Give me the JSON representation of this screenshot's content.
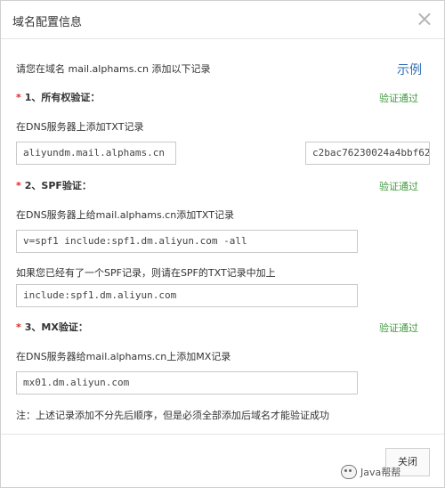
{
  "dialog": {
    "title": "域名配置信息",
    "close_glyph": "×",
    "intro": "请您在域名 mail.alphams.cn 添加以下记录",
    "example_link": "示例"
  },
  "steps": [
    {
      "star": "*",
      "title": "1、所有权验证：",
      "status": "验证通过",
      "instruction": "在DNS服务器上添加TXT记录",
      "fields": [
        "aliyundm.mail.alphams.cn",
        "c2bac76230024a4bbf62"
      ]
    },
    {
      "star": "*",
      "title": "2、SPF验证：",
      "status": "验证通过",
      "instruction": "在DNS服务器上给mail.alphams.cn添加TXT记录",
      "fields": [
        "v=spf1 include:spf1.dm.aliyun.com -all"
      ],
      "extra_instruction": "如果您已经有了一个SPF记录，则请在SPF的TXT记录中加上",
      "extra_field": "include:spf1.dm.aliyun.com"
    },
    {
      "star": "*",
      "title": "3、MX验证：",
      "status": "验证通过",
      "instruction": "在DNS服务器给mail.alphams.cn上添加MX记录",
      "fields": [
        "mx01.dm.aliyun.com"
      ]
    }
  ],
  "note": "注：上述记录添加不分先后顺序，但是必须全部添加后域名才能验证成功",
  "footer": {
    "close_button": "关闭"
  },
  "watermark": {
    "text": "Java帮帮"
  },
  "colors": {
    "verified": "#3e9b3e",
    "link": "#2f6db5",
    "required_star": "#e02424"
  }
}
